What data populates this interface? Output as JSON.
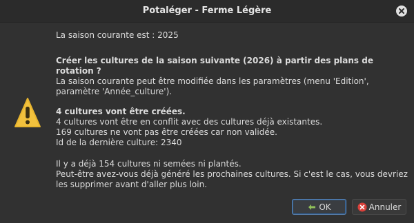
{
  "window": {
    "title": "Potaléger - Ferme Légère",
    "close_icon": "close-icon"
  },
  "message": {
    "season_line": "La saison courante est : 2025",
    "question": "Créer les cultures de la saison suivante (2026) à partir des plans de rotation ?",
    "settings_note": "La saison courante peut être modifiée dans les paramètres (menu 'Edition', paramètre 'Année_culture').",
    "created_count": "4 cultures vont être créées.",
    "conflict_line": "4 cultures vont être en conflit avec des cultures déjà existantes.",
    "not_created_line": "169 cultures ne vont pas être créées car non validée.",
    "last_id_line": "Id de la dernière culture: 2340",
    "existing_line": "Il y a déjà 154 cultures ni semées ni plantés.",
    "advice": "Peut-être avez-vous déjà généré les prochaines cultures. Si c'est le cas, vous devriez les supprimer avant d'aller plus loin."
  },
  "buttons": {
    "ok_label": "OK",
    "cancel_label": "Annuler"
  },
  "icons": {
    "warning": "warning-icon",
    "ok": "ok-icon",
    "cancel": "cancel-icon"
  },
  "colors": {
    "warning_fill": "#f2c13d",
    "cancel_red": "#d9403a",
    "ok_border": "#5a86b8"
  }
}
